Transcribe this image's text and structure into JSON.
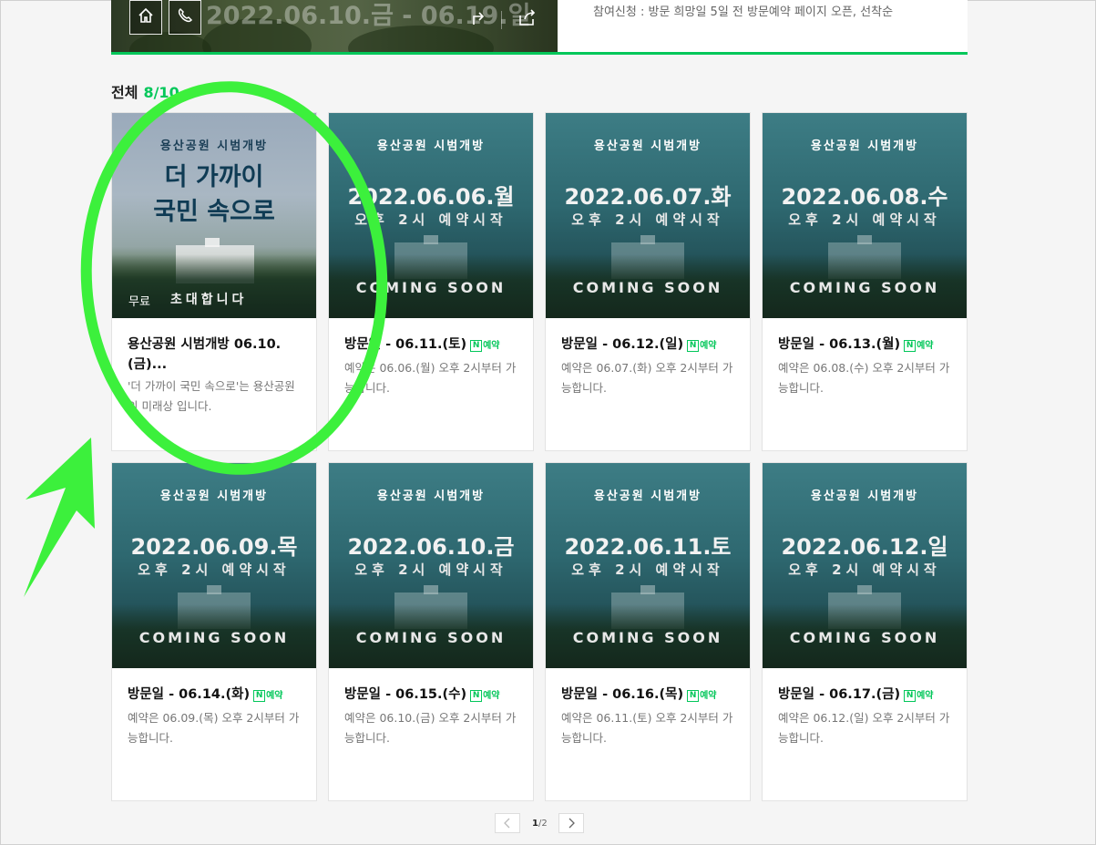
{
  "banner": {
    "date_range": "2022.06.10.금 - 06.19.일",
    "info": "참여신청 : 방문 희망일 5일 전 방문예약 페이지 오픈, 선착순",
    "icons": [
      "home-icon",
      "phone-icon",
      "directions-icon",
      "share-icon"
    ]
  },
  "list": {
    "label": "전체",
    "count": "8/10"
  },
  "featured": {
    "sub": "용산공원 시범개방",
    "headline_1": "더 가까이",
    "headline_2": "국민 속으로",
    "invite": "초대합니다",
    "badge": "무료",
    "title": "용산공원 시범개방 06.10.(금)...",
    "desc": "'더 가까이 국민 속으로'는 용산공원의 미래상 입니다."
  },
  "cards": [
    {
      "sub": "용산공원 시범개방",
      "date": "2022.06.06.월",
      "time": "오후 2시 예약시작",
      "soon": "COMING SOON",
      "title": "방문일 - 06.11.(토)",
      "reserve": "예약",
      "desc": "예약은 06.06.(월) 오후 2시부터 가능합니다."
    },
    {
      "sub": "용산공원 시범개방",
      "date": "2022.06.07.화",
      "time": "오후 2시 예약시작",
      "soon": "COMING SOON",
      "title": "방문일 - 06.12.(일)",
      "reserve": "예약",
      "desc": "예약은 06.07.(화) 오후 2시부터 가능합니다."
    },
    {
      "sub": "용산공원 시범개방",
      "date": "2022.06.08.수",
      "time": "오후 2시 예약시작",
      "soon": "COMING SOON",
      "title": "방문일 - 06.13.(월)",
      "reserve": "예약",
      "desc": "예약은 06.08.(수) 오후 2시부터 가능합니다."
    },
    {
      "sub": "용산공원 시범개방",
      "date": "2022.06.09.목",
      "time": "오후 2시 예약시작",
      "soon": "COMING SOON",
      "title": "방문일 - 06.14.(화)",
      "reserve": "예약",
      "desc": "예약은 06.09.(목) 오후 2시부터 가능합니다."
    },
    {
      "sub": "용산공원 시범개방",
      "date": "2022.06.10.금",
      "time": "오후 2시 예약시작",
      "soon": "COMING SOON",
      "title": "방문일 - 06.15.(수)",
      "reserve": "예약",
      "desc": "예약은 06.10.(금) 오후 2시부터 가능합니다."
    },
    {
      "sub": "용산공원 시범개방",
      "date": "2022.06.11.토",
      "time": "오후 2시 예약시작",
      "soon": "COMING SOON",
      "title": "방문일 - 06.16.(목)",
      "reserve": "예약",
      "desc": "예약은 06.11.(토) 오후 2시부터 가능합니다."
    },
    {
      "sub": "용산공원 시범개방",
      "date": "2022.06.12.일",
      "time": "오후 2시 예약시작",
      "soon": "COMING SOON",
      "title": "방문일 - 06.17.(금)",
      "reserve": "예약",
      "desc": "예약은 06.12.(일) 오후 2시부터 가능합니다."
    }
  ],
  "pagination": {
    "current": "1",
    "total": "/2"
  },
  "annotation": {
    "color": "#3cf03c",
    "shapes": [
      "ellipse",
      "arrow"
    ]
  }
}
